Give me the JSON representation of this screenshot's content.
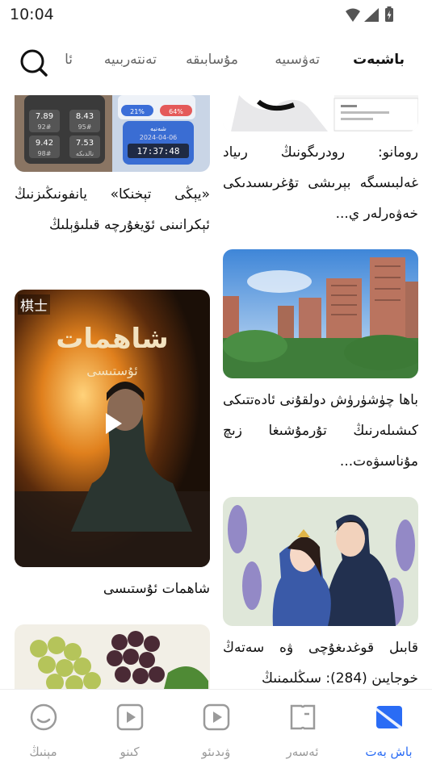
{
  "status_bar": {
    "time": "10:04",
    "icons": [
      "wifi-icon",
      "signal-icon",
      "battery-charging-icon"
    ]
  },
  "top_tabs": {
    "items": [
      {
        "label": "باشبەت",
        "active": true
      },
      {
        "label": "تەۋسىيە",
        "active": false
      },
      {
        "label": "مۇسابىقە",
        "active": false
      },
      {
        "label": "تەنتەربىيە",
        "active": false
      },
      {
        "label": "ئا",
        "active": false
      }
    ],
    "search_icon": "search-icon"
  },
  "feed": {
    "left_column": [
      {
        "title": "«يېڭى تېخنكا» يانفونىڭىزنىڭ ئېكرانىنى ئۆيغۇرچە قىلىۋېلىڭ",
        "image": "phone-widgets-image",
        "widget_values": [
          "7.89",
          "8.43",
          "92#",
          "95#",
          "9.42",
          "7.53",
          "98#",
          "نالدىكە",
          "17:37:48",
          "شەنبە",
          "2024-04-06",
          "21%",
          "64%"
        ]
      },
      {
        "title": "شاھمات ئۇستىسى",
        "image": "video-poster-image",
        "badge": "棋士",
        "poster_title": "شاھمات",
        "poster_subtitle": "ئۇستىسى",
        "is_video": true
      },
      {
        "title": "",
        "image": "grapes-image"
      }
    ],
    "right_column": [
      {
        "title": "رومانو: رودرىگونىڭ رىياد غەلبىسىگە بېرىشى تۇغرىسىدىكى خەۋەرلەر ي...",
        "image": "football-player-image"
      },
      {
        "title": "باھا چۈشۈرۈش دولقۇنى ئادەتتىكى كىشىلەرنىڭ تۇرمۇشىغا زىچ مۇناسىۋەت...",
        "image": "apartment-buildings-image"
      },
      {
        "title": "قابىل قوغدىغۇچى ۋە سەتەڭ خوجايىن (284): سىڭلىمنىڭ",
        "image": "romance-couple-image"
      }
    ]
  },
  "bottom_nav": {
    "items": [
      {
        "label": "باش بەت",
        "icon": "home-icon",
        "active": true
      },
      {
        "label": "ئەسەر",
        "icon": "book-icon",
        "active": false
      },
      {
        "label": "ۋىدىئو",
        "icon": "video-icon",
        "active": false
      },
      {
        "label": "كىنو",
        "icon": "movie-icon",
        "active": false
      },
      {
        "label": "مېنىڭ",
        "icon": "profile-icon",
        "active": false
      }
    ]
  },
  "colors": {
    "accent": "#2a6cf5",
    "inactive": "#9a9a9a",
    "text": "#111111"
  }
}
